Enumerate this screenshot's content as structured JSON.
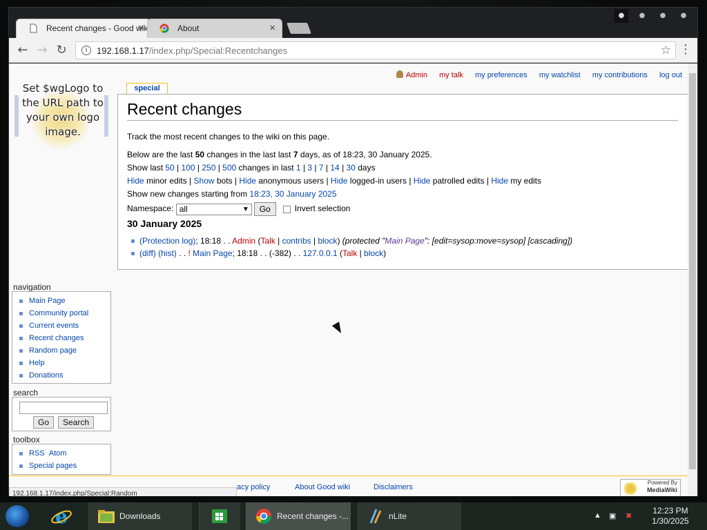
{
  "tabs": [
    {
      "title": "Recent changes - Good wiki",
      "close": "×"
    },
    {
      "title": "About",
      "close": "×"
    }
  ],
  "url": {
    "host": "192.168.1.17",
    "path": "/index.php/Special:Recentchanges"
  },
  "personal": {
    "user": "Admin",
    "talk": "my talk",
    "prefs": "my preferences",
    "watchlist": "my watchlist",
    "contribs": "my contributions",
    "logout": "log out"
  },
  "logo": {
    "text": "Set $wgLogo to the URL path to your own logo image."
  },
  "special_tab": "special",
  "heading": "Recent changes",
  "intro": "Track the most recent changes to the wiki on this page.",
  "summary": {
    "prefix": "Below are the last ",
    "count": "50",
    "mid": " changes in the last last ",
    "days": "7",
    "suffix": " days, as of 18:23, 30 January 2025."
  },
  "show_last": {
    "label": "Show last ",
    "limits": [
      "50",
      "100",
      "250",
      "500"
    ],
    "mid": " changes in last ",
    "days": [
      "1",
      "3",
      "7",
      "14",
      "30"
    ],
    "suffix": " days"
  },
  "toggles": [
    {
      "link": "Hide",
      "label": " minor edits"
    },
    {
      "link": "Show",
      "label": " bots"
    },
    {
      "link": "Hide",
      "label": " anonymous users"
    },
    {
      "link": "Hide",
      "label": " logged-in users"
    },
    {
      "link": "Hide",
      "label": " patrolled edits"
    },
    {
      "link": "Hide",
      "label": " my edits"
    }
  ],
  "new_changes": {
    "label": "Show new changes starting from ",
    "link": "18:23, 30 January 2025"
  },
  "namespace": {
    "label": "Namespace:",
    "value": "all",
    "go": "Go",
    "invert": "Invert selection"
  },
  "date_heading": "30 January 2025",
  "changes": [
    {
      "log": "(Protection log)",
      "time": "18:18",
      "user": "Admin",
      "talk": "Talk",
      "contribs": "contribs",
      "block": "block",
      "comment_pre": "(protected \"",
      "page": "Main Page",
      "comment_post": "\": [edit=sysop:move=sysop] [cascading])"
    },
    {
      "diff": "(diff)",
      "hist": "(hist)",
      "flag": "!",
      "page": "Main Page",
      "time": "18:18",
      "size": "(-382)",
      "ip": "127.0.0.1",
      "talk": "Talk",
      "block": "block"
    }
  ],
  "sidebar": {
    "navigation_title": "navigation",
    "navigation": [
      "Main Page",
      "Community portal",
      "Current events",
      "Recent changes",
      "Random page",
      "Help",
      "Donations"
    ],
    "search_title": "search",
    "search_go": "Go",
    "search_btn": "Search",
    "toolbox_title": "toolbox",
    "toolbox_rss": "RSS",
    "toolbox_atom": "Atom",
    "toolbox_special": "Special pages"
  },
  "footer": {
    "privacy": "acy policy",
    "about": "About Good wiki",
    "disclaimers": "Disclaimers",
    "powered_small": "Powered By",
    "powered_big": "MediaWiki"
  },
  "status_url": "192.168.1.17/index.php/Special:Random",
  "taskbar": {
    "items": [
      "Downloads",
      "Recent changes -...",
      "nLite"
    ],
    "time": "12:23 PM",
    "date": "1/30/2025"
  }
}
